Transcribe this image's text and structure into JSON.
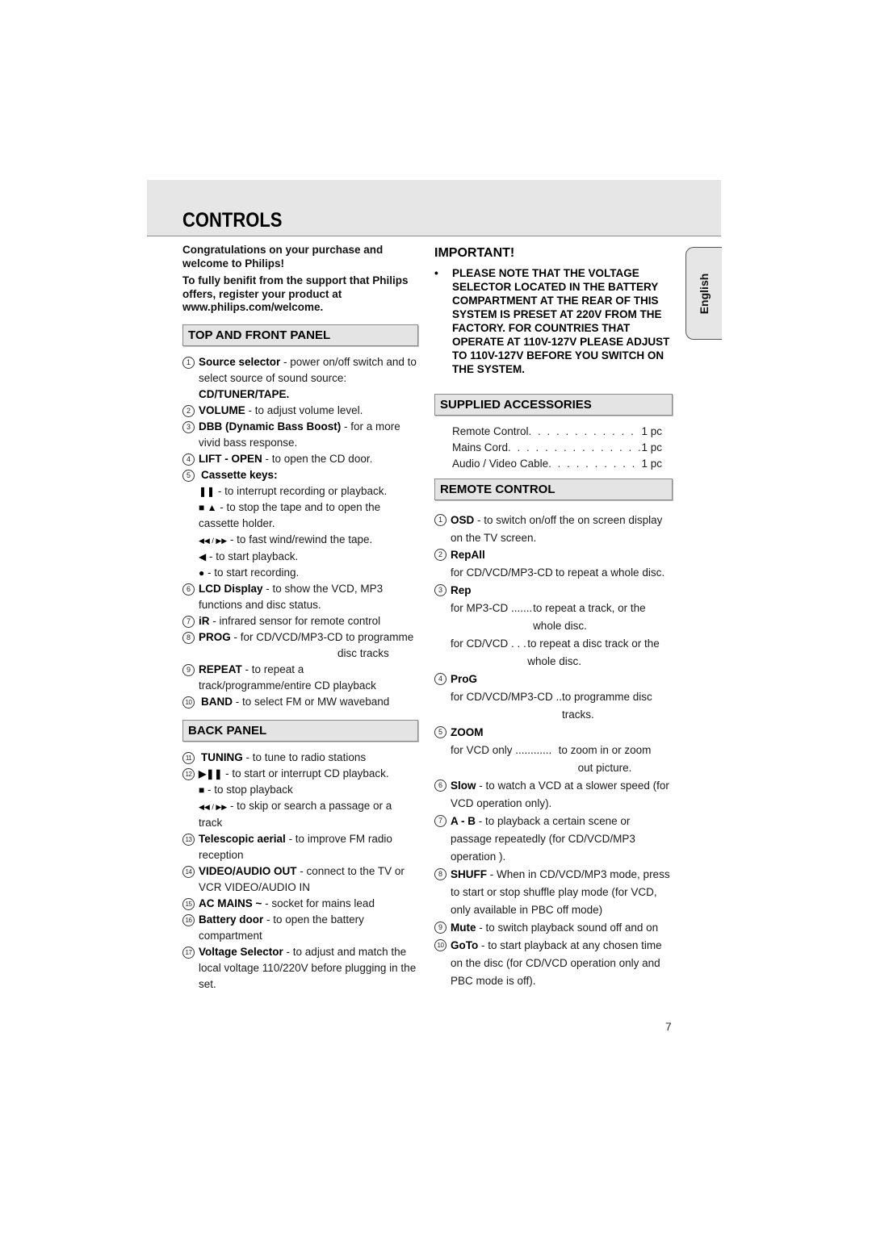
{
  "header": {
    "title": "CONTROLS"
  },
  "language_tab": "English",
  "page_number": "7",
  "intro": {
    "congrats": "Congratulations on your purchase and welcome to Philips!",
    "register": "To fully benifit from the support that Philips offers, register your product at www.philips.com/welcome."
  },
  "top_front_panel": {
    "title": "TOP AND FRONT PANEL",
    "items": [
      {
        "num": "1",
        "label": "Source selector",
        "desc": " - power on/off switch and to select source of sound source:",
        "extra": "CD/TUNER/TAPE."
      },
      {
        "num": "2",
        "label": "VOLUME",
        "desc": " - to adjust volume level."
      },
      {
        "num": "3",
        "label": "DBB (Dynamic Bass Boost)",
        "desc": " -  for a more vivid bass response."
      },
      {
        "num": "4",
        "label": "LIFT - OPEN",
        "desc": " - to open the CD door."
      },
      {
        "num": "5",
        "label": "Cassette keys:",
        "desc": ""
      },
      {
        "num": "6",
        "label": "LCD Display",
        "desc": " - to show the VCD, MP3 functions and disc status."
      },
      {
        "num": "7",
        "label": "iR",
        "desc": " - infrared sensor for remote control"
      },
      {
        "num": "8",
        "label": "PROG",
        "desc": " - for CD/VCD/MP3-CD  to programme",
        "desc2": "disc tracks"
      },
      {
        "num": "9",
        "label": "REPEAT",
        "desc": " - to repeat a track/programme/entire CD playback"
      },
      {
        "num": "10",
        "label": "BAND",
        "desc": " -  to select FM or MW waveband"
      }
    ],
    "cassette_keys": [
      {
        "icon": "pause-icon",
        "glyph": "❚❚",
        "desc": " - to interrupt recording or playback."
      },
      {
        "icon": "stop-eject-icon",
        "glyph": "■ ▲",
        "desc": " - to stop the tape and to open the cassette holder."
      },
      {
        "icon": "rewind-forward-icon",
        "glyph": "◀◀ / ▶▶",
        "desc": " - to fast wind/rewind the tape."
      },
      {
        "icon": "play-icon",
        "glyph": "◀",
        "desc": " - to start playback."
      },
      {
        "icon": "record-icon",
        "glyph": "●",
        "desc": " - to start recording."
      }
    ]
  },
  "back_panel": {
    "title": "BACK PANEL",
    "items": [
      {
        "num": "11",
        "label": "TUNING",
        "desc": " - to tune to radio stations"
      },
      {
        "num": "12",
        "label": "▶❚❚",
        "desc": " - to start or interrupt CD playback."
      },
      {
        "num": "13",
        "label": "Telescopic aerial",
        "desc": " - to improve FM radio reception"
      },
      {
        "num": "14",
        "label": "VIDEO/AUDIO OUT",
        "desc": " - connect to the TV or VCR VIDEO/AUDIO IN"
      },
      {
        "num": "15",
        "label": "AC MAINS ~",
        "desc": " - socket for mains lead"
      },
      {
        "num": "16",
        "label": "Battery door",
        "desc": " - to open the battery compartment"
      },
      {
        "num": "17",
        "label": "Voltage Selector",
        "desc": " - to adjust and match the local voltage 110/220V before plugging in the set."
      }
    ],
    "item12_sub": [
      {
        "icon": "stop-icon",
        "glyph": "■",
        "desc": " - to stop playback"
      },
      {
        "icon": "skip-icon",
        "glyph": "◀◀ / ▶▶",
        "desc": " - to skip or search a passage or a track"
      }
    ]
  },
  "important": {
    "title": "IMPORTANT!",
    "text": "PLEASE NOTE THAT THE VOLTAGE SELECTOR LOCATED IN THE BATTERY COMPARTMENT AT THE REAR OF THIS SYSTEM IS PRESET AT 220V FROM THE FACTORY. FOR COUNTRIES THAT OPERATE AT 110V-127V PLEASE ADJUST TO 110V-127V BEFORE YOU SWITCH ON THE SYSTEM."
  },
  "supplied_accessories": {
    "title": "SUPPLIED ACCESSORIES",
    "items": [
      {
        "name": "Remote Control",
        "qty": "1 pc"
      },
      {
        "name": "Mains Cord",
        "qty": "1 pc"
      },
      {
        "name": "Audio / Video Cable",
        "qty": "1 pc"
      }
    ]
  },
  "remote_control": {
    "title": "REMOTE CONTROL",
    "items": [
      {
        "num": "1",
        "label": "OSD",
        "desc": " - to switch on/off the on screen display on the TV screen."
      },
      {
        "num": "2",
        "label": "RepAll",
        "lines": [
          {
            "lhs": "for CD/VCD/MP3-CD",
            "rhs": "to repeat a whole disc."
          }
        ]
      },
      {
        "num": "3",
        "label": "Rep",
        "lines": [
          {
            "lhs": "for MP3-CD ................",
            "rhs": "to repeat a track, or the whole disc."
          },
          {
            "lhs": "for CD/VCD  . . . . . . . .",
            "rhs": "to repeat a disc track or the whole disc."
          }
        ]
      },
      {
        "num": "4",
        "label": "ProG",
        "lines": [
          {
            "lhs": "for CD/VCD/MP3-CD ..",
            "rhs": "to programme disc tracks."
          }
        ]
      },
      {
        "num": "5",
        "label": "ZOOM",
        "lines": [
          {
            "lhs": "for VCD only ...............",
            "rhs": "to zoom in or zoom out picture."
          }
        ]
      },
      {
        "num": "6",
        "label": "Slow",
        "desc": " - to watch a VCD at a slower speed (for VCD operation only)."
      },
      {
        "num": "7",
        "label": "A - B",
        "desc": " - to playback a certain scene or passage repeatedly (for CD/VCD/MP3 operation )."
      },
      {
        "num": "8",
        "label": "SHUFF",
        "desc": " - When in CD/VCD/MP3 mode, press to start or stop shuffle play mode (for VCD, only available in PBC off mode)"
      },
      {
        "num": "9",
        "label": "Mute",
        "desc": " - to switch playback sound off and on"
      },
      {
        "num": "10",
        "label": "GoTo",
        "desc": " - to start playback at any chosen time on the disc (for CD/VCD operation only and PBC mode is off)."
      }
    ]
  }
}
